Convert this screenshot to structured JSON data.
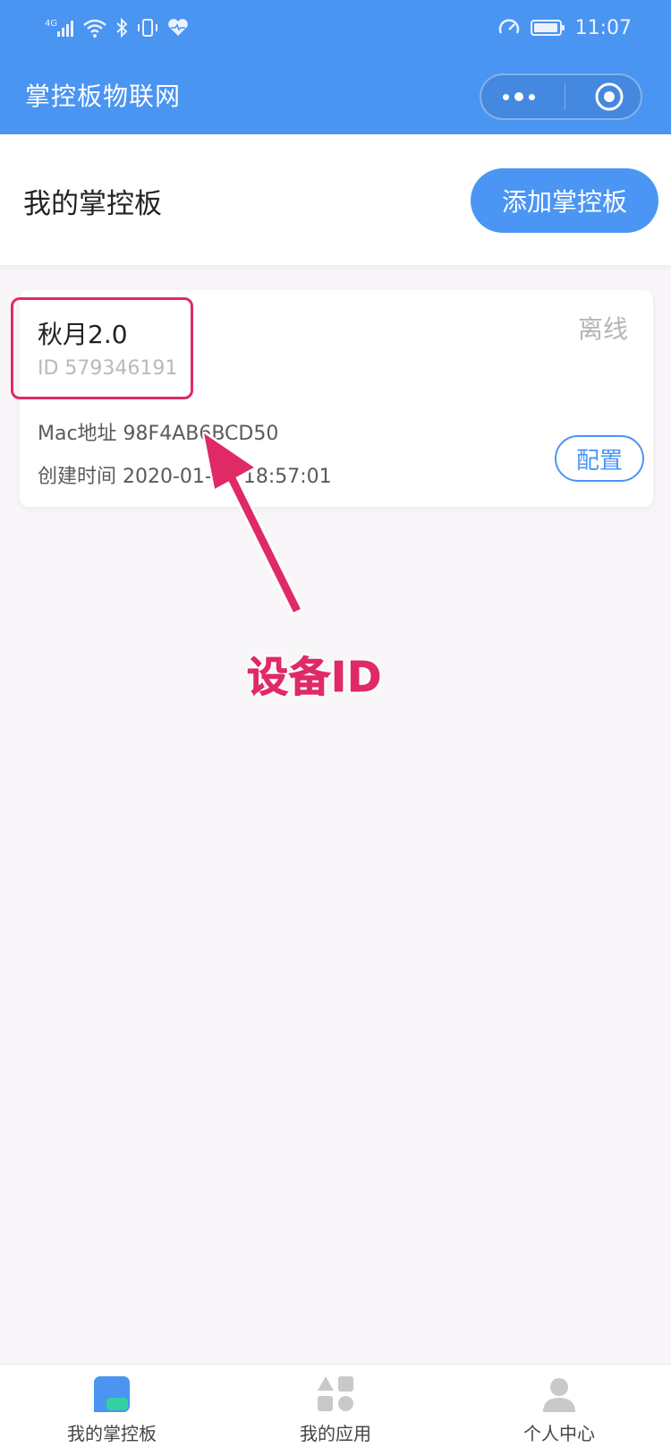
{
  "status_bar": {
    "time": "11:07",
    "icons": [
      "network-4g-icon",
      "wifi-icon",
      "bluetooth-icon",
      "vibrate-icon",
      "heart-icon",
      "data-saver-icon",
      "battery-icon"
    ]
  },
  "nav": {
    "title": "掌控板物联网",
    "menu_icon": "more-dots-icon",
    "close_icon": "target-close-icon"
  },
  "header": {
    "title": "我的掌控板",
    "add_button_label": "添加掌控板"
  },
  "device": {
    "name": "秋月2.0",
    "id_label": "ID 579346191",
    "status": "离线",
    "mac_label": "Mac地址 98F4AB6BCD50",
    "created_label": "创建时间 2020-01-23 18:57:01",
    "config_button_label": "配置"
  },
  "annotation": {
    "label": "设备ID",
    "color": "#e02a66"
  },
  "tabbar": {
    "tabs": [
      {
        "label": "我的掌控板",
        "icon": "board-icon",
        "active": true
      },
      {
        "label": "我的应用",
        "icon": "apps-grid-icon",
        "active": false
      },
      {
        "label": "个人中心",
        "icon": "user-icon",
        "active": false
      }
    ]
  },
  "colors": {
    "primary": "#4a94f2",
    "annotation": "#e02a66",
    "accent_green": "#34d1a0"
  }
}
